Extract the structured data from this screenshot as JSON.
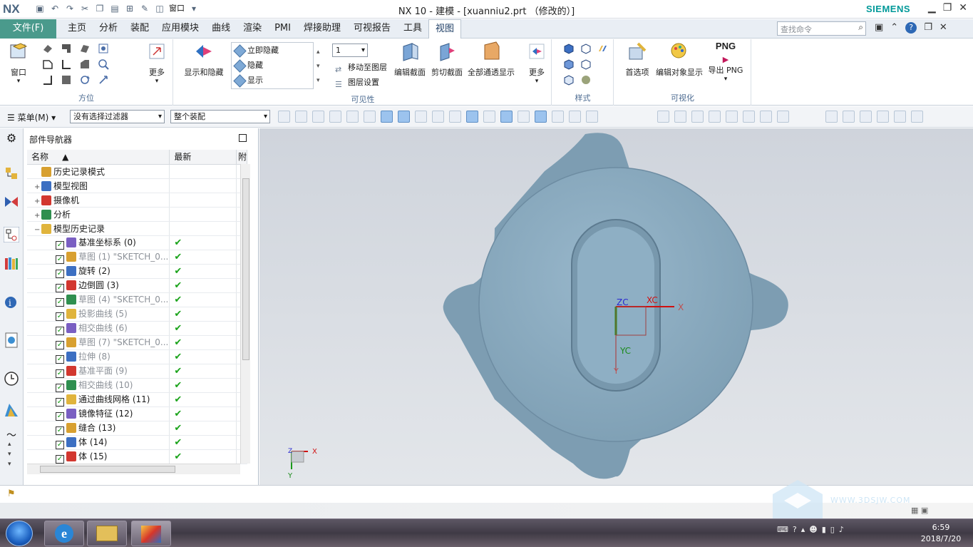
{
  "window": {
    "app_logo": "NX",
    "title": "NX 10 - 建模 - [xuanniu2.prt （修改的）]",
    "brand": "SIEMENS",
    "window_menu": "窗口"
  },
  "ribbon_tabs": {
    "file": "文件(F)",
    "tabs": [
      "主页",
      "分析",
      "装配",
      "应用模块",
      "曲线",
      "渲染",
      "PMI",
      "焊接助理",
      "可视报告",
      "工具",
      "视图"
    ],
    "active": "视图"
  },
  "search": {
    "placeholder": "查找命令"
  },
  "ribbon": {
    "window_btn": "窗口",
    "more1": "更多",
    "group_orient": "方位",
    "show_hide": "显示和隐藏",
    "visibility_list": [
      "立即隐藏",
      "隐藏",
      "显示"
    ],
    "layer_value": "1",
    "move_to_layer": "移动至图层",
    "layer_settings": "图层设置",
    "edit_section": "编辑截面",
    "clip_section": "剪切截面",
    "show_all": "全部通透显示",
    "more2": "更多",
    "group_visibility": "可见性",
    "group_style": "样式",
    "preferences": "首选项",
    "edit_obj_display": "编辑对象显示",
    "export_png": "导出 PNG",
    "png_label": "PNG",
    "group_visualize": "可视化"
  },
  "toolbar": {
    "menu": "菜单(M)",
    "filter": "没有选择过滤器",
    "assembly": "整个装配"
  },
  "navigator": {
    "title": "部件导航器",
    "col_name": "名称",
    "col_latest": "最新",
    "col_extra": "附",
    "rows": [
      {
        "label": "历史记录模式",
        "level": 0,
        "check": false,
        "latest": "",
        "dim": false,
        "expand": ""
      },
      {
        "label": "模型视图",
        "level": 0,
        "check": false,
        "latest": "",
        "dim": false,
        "expand": "+"
      },
      {
        "label": "摄像机",
        "level": 0,
        "check": false,
        "latest": "",
        "dim": false,
        "expand": "+"
      },
      {
        "label": "分析",
        "level": 0,
        "check": false,
        "latest": "",
        "dim": false,
        "expand": "+"
      },
      {
        "label": "模型历史记录",
        "level": 0,
        "check": false,
        "latest": "",
        "dim": false,
        "expand": "−"
      },
      {
        "label": "基准坐标系 (0)",
        "level": 1,
        "check": true,
        "latest": "✔",
        "dim": false
      },
      {
        "label": "草图 (1) \"SKETCH_0...",
        "level": 1,
        "check": true,
        "latest": "✔",
        "dim": true
      },
      {
        "label": "旋转 (2)",
        "level": 1,
        "check": true,
        "latest": "✔",
        "dim": false
      },
      {
        "label": "边倒圆 (3)",
        "level": 1,
        "check": true,
        "latest": "✔",
        "dim": false
      },
      {
        "label": "草图 (4) \"SKETCH_0...",
        "level": 1,
        "check": true,
        "latest": "✔",
        "dim": true
      },
      {
        "label": "投影曲线 (5)",
        "level": 1,
        "check": true,
        "latest": "✔",
        "dim": true
      },
      {
        "label": "相交曲线 (6)",
        "level": 1,
        "check": true,
        "latest": "✔",
        "dim": true
      },
      {
        "label": "草图 (7) \"SKETCH_0...",
        "level": 1,
        "check": true,
        "latest": "✔",
        "dim": true
      },
      {
        "label": "拉伸 (8)",
        "level": 1,
        "check": true,
        "latest": "✔",
        "dim": true
      },
      {
        "label": "基准平面 (9)",
        "level": 1,
        "check": true,
        "latest": "✔",
        "dim": true
      },
      {
        "label": "相交曲线 (10)",
        "level": 1,
        "check": true,
        "latest": "✔",
        "dim": true
      },
      {
        "label": "通过曲线网格 (11)",
        "level": 1,
        "check": true,
        "latest": "✔",
        "dim": false
      },
      {
        "label": "镜像特征 (12)",
        "level": 1,
        "check": true,
        "latest": "✔",
        "dim": false
      },
      {
        "label": "缝合 (13)",
        "level": 1,
        "check": true,
        "latest": "✔",
        "dim": false
      },
      {
        "label": "体 (14)",
        "level": 1,
        "check": true,
        "latest": "✔",
        "dim": false
      },
      {
        "label": "体 (15)",
        "level": 1,
        "check": true,
        "latest": "✔",
        "dim": false
      }
    ]
  },
  "viewport": {
    "axes": {
      "zc": "ZC",
      "xc": "XC",
      "yc": "YC",
      "x": "X",
      "y": "Y",
      "z": "Z"
    },
    "watermark": "WWW.3DSJW.COM"
  },
  "taskbar": {
    "time": "6:59",
    "date": "2018/7/20"
  },
  "colors": {
    "ribbon_file": "#4a9a8c",
    "model": "#8fb2c8",
    "viewport_bg": "#d6dae0"
  }
}
